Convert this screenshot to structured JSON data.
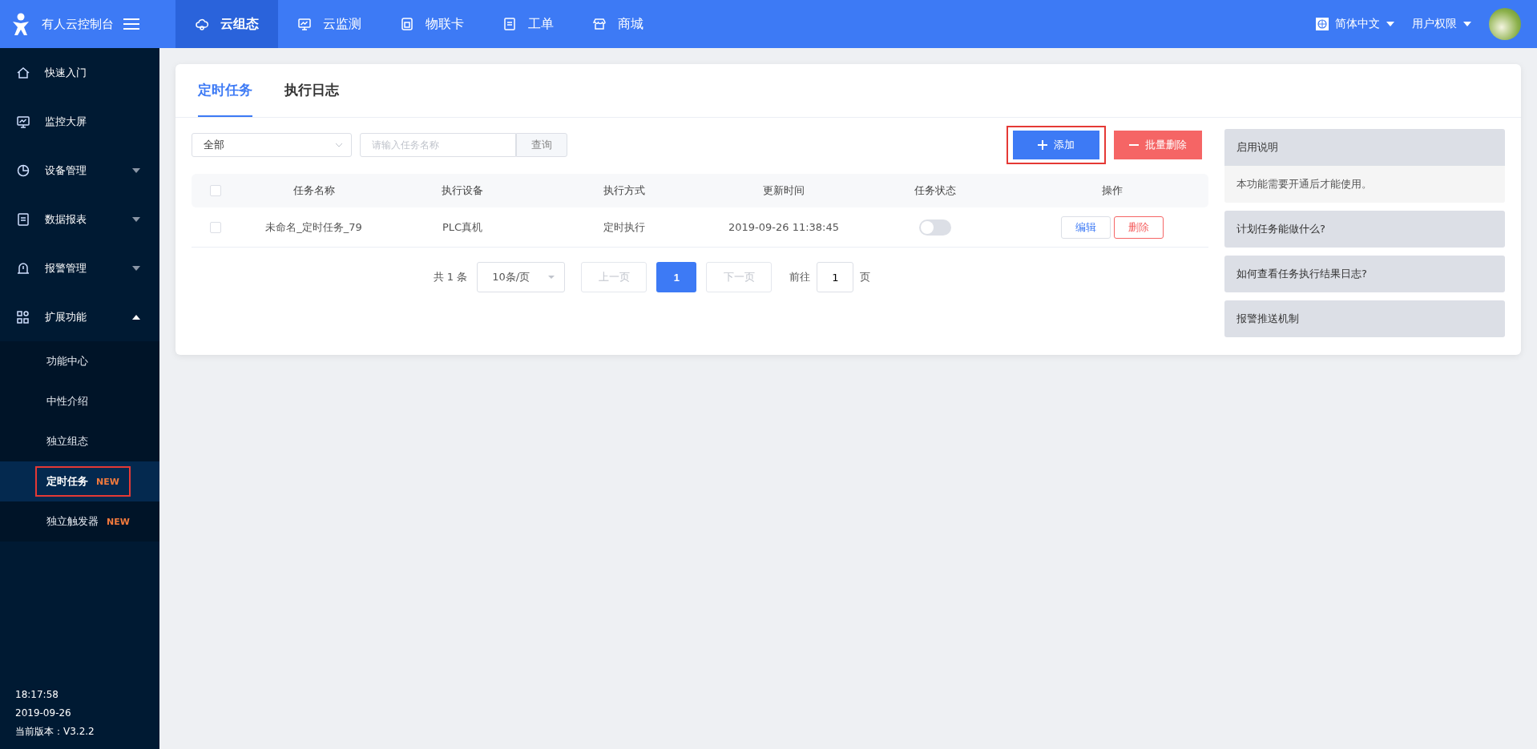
{
  "topbar": {
    "brand": "有人云控制台",
    "nav": [
      {
        "label": "云组态",
        "selected": true
      },
      {
        "label": "云监测",
        "selected": false
      },
      {
        "label": "物联卡",
        "selected": false
      },
      {
        "label": "工单",
        "selected": false
      },
      {
        "label": "商城",
        "selected": false
      }
    ],
    "language": "简体中文",
    "user_menu": "用户权限"
  },
  "sidebar": {
    "items": [
      {
        "label": "快速入门"
      },
      {
        "label": "监控大屏"
      },
      {
        "label": "设备管理",
        "expanded": false
      },
      {
        "label": "数据报表",
        "expanded": false
      },
      {
        "label": "报警管理",
        "expanded": false
      },
      {
        "label": "扩展功能",
        "expanded": true,
        "children": [
          {
            "label": "功能中心",
            "selected": false,
            "highlighted": false
          },
          {
            "label": "中性介绍",
            "selected": false,
            "highlighted": false
          },
          {
            "label": "独立组态",
            "selected": false,
            "highlighted": false
          },
          {
            "label": "定时任务",
            "badge": "NEW",
            "selected": true,
            "highlighted": true
          },
          {
            "label": "独立触发器",
            "badge": "NEW",
            "selected": false,
            "highlighted": false
          }
        ]
      }
    ],
    "footer": [
      "18:17:58",
      "2019-09-26",
      "当前版本：V3.2.2"
    ]
  },
  "tabs": [
    {
      "label": "定时任务",
      "selected": true
    },
    {
      "label": "执行日志",
      "selected": false
    }
  ],
  "filters": {
    "select_value": "全部",
    "search": {
      "placeholder": "请输入任务名称"
    },
    "query_button": "查询"
  },
  "buttons": [
    {
      "label": "添加",
      "kind": "add",
      "highlighted": true
    },
    {
      "label": "批量删除",
      "kind": "delete",
      "highlighted": false
    }
  ],
  "table": {
    "columns": [
      "任务名称",
      "执行设备",
      "执行方式",
      "更新时间",
      "任务状态",
      "操作"
    ],
    "header_checked": false,
    "rows": [
      {
        "checked": false,
        "name": "未命名_定时任务_79",
        "device": "PLC真机",
        "mode": "定时执行",
        "updated": "2019-09-26 11:38:45",
        "on": false,
        "actions": [
          "编辑",
          "删除"
        ]
      }
    ]
  },
  "pagination": {
    "total": "共 1 条",
    "page_size": "10条/页",
    "prev": "上一页",
    "pages": [
      {
        "label": "1",
        "selected": true
      }
    ],
    "next": "下一页",
    "goto_label": "前往",
    "goto_value": "1",
    "goto_suffix": "页"
  },
  "help": [
    {
      "title": "启用说明",
      "body": "本功能需要开通后才能使用。"
    },
    {
      "title": "计划任务能做什么?"
    },
    {
      "title": "如何查看任务执行结果日志?"
    },
    {
      "title": "报警推送机制"
    }
  ]
}
